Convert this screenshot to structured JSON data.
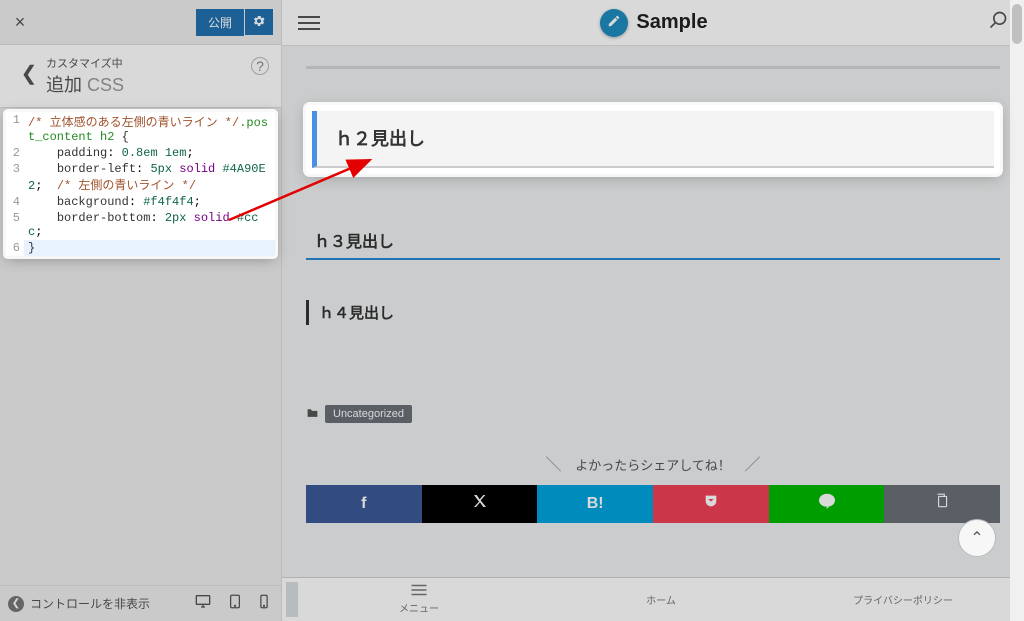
{
  "customizer": {
    "publish_label": "公開",
    "customizing_label": "カスタマイズ中",
    "section_label_prefix": "追加",
    "section_label_suffix": "CSS",
    "hide_controls_label": "コントロールを非表示"
  },
  "css": {
    "l1": "/* 立体感のある左側の青いライン */.post_content h2 {",
    "l2": "    padding: 0.8em 1em;",
    "l3": "    border-left: 5px solid #4A90E2;  /* 左側の青いライン */",
    "l4": "    background: #f4f4f4;",
    "l5": "    border-bottom: 2px solid #ccc;",
    "l6": "}"
  },
  "preview": {
    "site_title": "Sample",
    "h2": "ｈ２見出し",
    "h3": "ｈ３見出し",
    "h4": "ｈ４見出し",
    "category": "Uncategorized",
    "share_text": "よかったらシェアしてね！",
    "hatena_label": "B!"
  },
  "bottom_nav": {
    "menu": "メニュー",
    "home": "ホーム",
    "privacy": "プライバシーポリシー"
  }
}
